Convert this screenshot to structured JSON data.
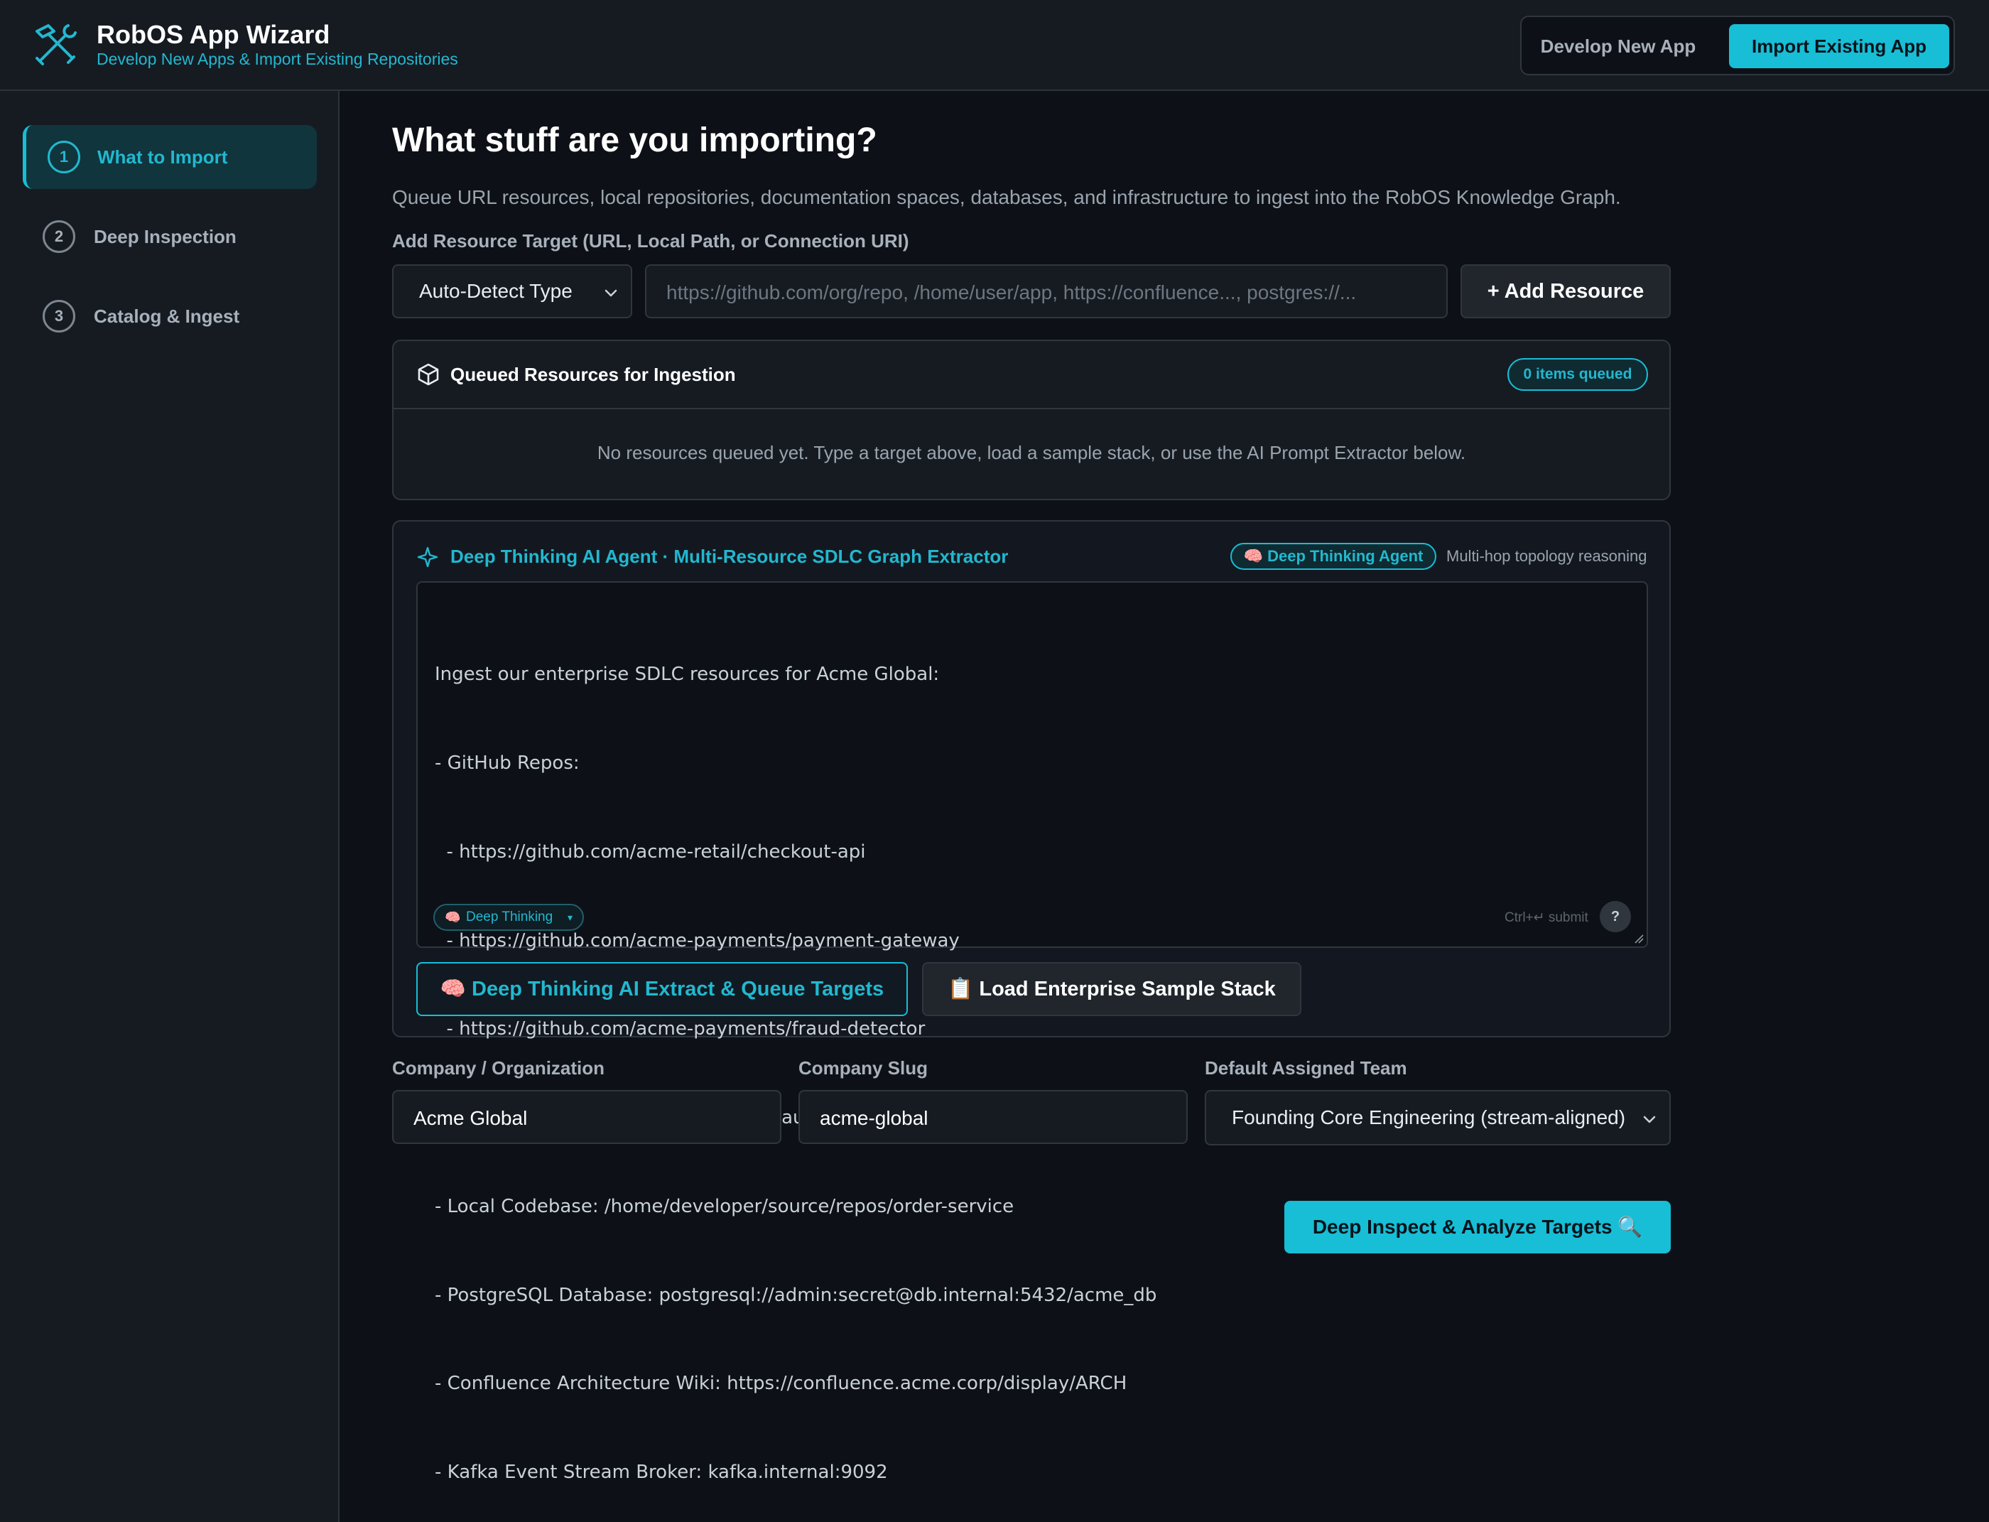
{
  "app": {
    "title": "RobOS App Wizard",
    "subtitle": "Develop New Apps & Import Existing Repositories",
    "logo_icon": "tools-icon",
    "accent_color": "#17bed6"
  },
  "mode_toggle": {
    "develop_label": "Develop New App",
    "import_label": "Import Existing App",
    "active": "Import Existing App"
  },
  "steps": [
    {
      "number": "1",
      "label": "What to Import",
      "active": true
    },
    {
      "number": "2",
      "label": "Deep Inspection",
      "active": false
    },
    {
      "number": "3",
      "label": "Catalog & Ingest",
      "active": false
    }
  ],
  "main": {
    "title": "What stuff are you importing?",
    "description": "Queue URL resources, local repositories, documentation spaces, databases, and infrastructure to ingest into the RobOS Knowledge Graph.",
    "resource_label": "Add Resource Target (URL, Local Path, or Connection URI)",
    "type_select": "Auto-Detect Type",
    "resource_placeholder": "https://github.com/org/repo, /home/user/app, https://confluence..., postgres://...",
    "add_button": "+ Add Resource"
  },
  "queue": {
    "title": "Queued Resources for Ingestion",
    "icon": "cube-icon",
    "badge": "0 items queued",
    "empty_message": "No resources queued yet. Type a target above, load a sample stack, or use the AI Prompt Extractor below."
  },
  "ai_agent": {
    "title": "Deep Thinking AI Agent · Multi-Resource SDLC Graph Extractor",
    "icon": "sparkle-icon",
    "badge": "🧠 Deep Thinking Agent",
    "aux_text": "Multi-hop topology reasoning",
    "prompt_lines": [
      "Ingest our enterprise SDLC resources for Acme Global:",
      "- GitHub Repos:",
      "  - https://github.com/acme-retail/checkout-api",
      "  - https://github.com/acme-payments/payment-gateway",
      "  - https://github.com/acme-payments/fraud-detector",
      "  - https://github.com/acme-identity/oauth-server",
      "- Local Codebase: /home/developer/source/repos/order-service",
      "- PostgreSQL Database: postgresql://admin:secret@db.internal:5432/acme_db",
      "- Confluence Architecture Wiki: https://confluence.acme.corp/display/ARCH",
      "- Kafka Event Stream Broker: kafka.internal:9092"
    ],
    "mode_chip": "Deep Thinking",
    "submit_hint": "Ctrl+↵ submit",
    "help_label": "?",
    "extract_button": "🧠  Deep Thinking AI Extract & Queue Targets",
    "sample_button": "📋  Load Enterprise Sample Stack"
  },
  "org": {
    "company_label": "Company / Organization",
    "company_value": "Acme Global",
    "slug_label": "Company Slug",
    "slug_value": "acme-global",
    "team_label": "Default Assigned Team",
    "team_value": "Founding Core Engineering (stream-aligned)"
  },
  "cta": {
    "label": "Deep Inspect & Analyze Targets 🔍"
  }
}
